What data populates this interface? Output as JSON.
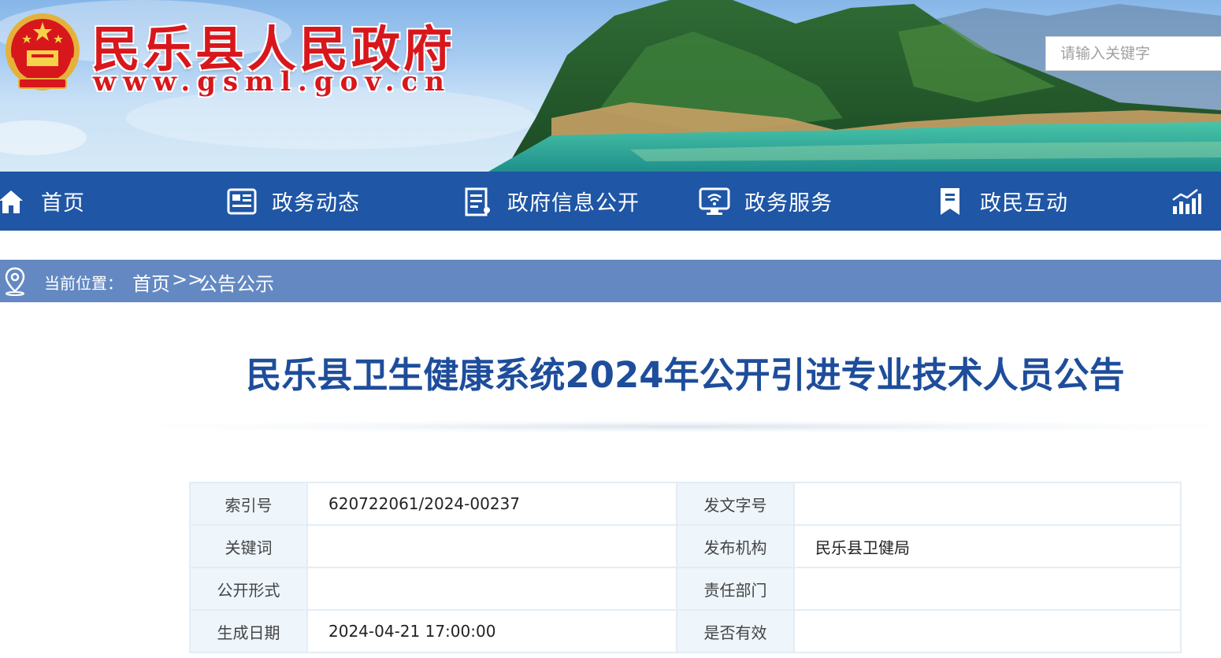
{
  "header": {
    "site_title": "民乐县人民政府",
    "site_url": "www.gsml.gov.cn",
    "search_placeholder": "请输入关键字"
  },
  "nav": {
    "items": [
      {
        "label": "首页",
        "icon": "home-icon"
      },
      {
        "label": "政务动态",
        "icon": "newspaper-icon"
      },
      {
        "label": "政府信息公开",
        "icon": "document-list-icon"
      },
      {
        "label": "政务服务",
        "icon": "monitor-service-icon"
      },
      {
        "label": "政民互动",
        "icon": "bookmark-icon"
      },
      {
        "label": "",
        "icon": "bar-chart-icon"
      }
    ]
  },
  "breadcrumb": {
    "prefix": "当前位置：",
    "home": "首页",
    "separator": ">>",
    "current": "公告公示"
  },
  "article": {
    "title": "民乐县卫生健康系统2024年公开引进专业技术人员公告"
  },
  "info_table": {
    "rows": [
      {
        "k1": "索引号",
        "v1": "620722061/2024-00237",
        "k2": "发文字号",
        "v2": ""
      },
      {
        "k1": "关键词",
        "v1": "",
        "k2": "发布机构",
        "v2": "民乐县卫健局"
      },
      {
        "k1": "公开形式",
        "v1": "",
        "k2": "责任部门",
        "v2": ""
      },
      {
        "k1": "生成日期",
        "v1": "2024-04-21 17:00:00",
        "k2": "是否有效",
        "v2": ""
      }
    ]
  },
  "colors": {
    "nav_bg": "#1f56a6",
    "breadcrumb_bg": "#6489c2",
    "title_blue": "#1e4d9b",
    "site_title_red": "#d8171c",
    "table_key_bg": "#eef5fb"
  }
}
